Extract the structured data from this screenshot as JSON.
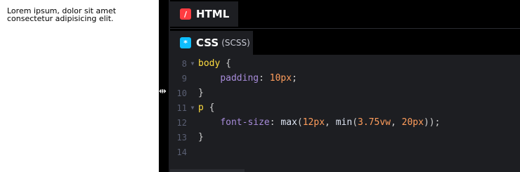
{
  "preview": {
    "text": "Lorem ipsum, dolor sit amet consectetur adipisicing elit."
  },
  "tabs": {
    "html": {
      "icon": "/",
      "title": "HTML"
    },
    "css": {
      "icon": "*",
      "title": "CSS",
      "subtitle": "(SCSS)"
    }
  },
  "code": {
    "lines": [
      {
        "n": "8",
        "fold": true,
        "indent": "",
        "parts": [
          [
            "sel",
            "body"
          ],
          [
            "punc",
            " {"
          ]
        ]
      },
      {
        "n": "9",
        "fold": false,
        "indent": "    ",
        "parts": [
          [
            "prop",
            "padding"
          ],
          [
            "punc",
            ": "
          ],
          [
            "num",
            "10px"
          ],
          [
            "punc",
            ";"
          ]
        ]
      },
      {
        "n": "10",
        "fold": false,
        "indent": "",
        "parts": [
          [
            "punc",
            "}"
          ]
        ]
      },
      {
        "n": "11",
        "fold": true,
        "indent": "",
        "parts": [
          [
            "sel",
            "p"
          ],
          [
            "punc",
            " {"
          ]
        ]
      },
      {
        "n": "12",
        "fold": false,
        "indent": "    ",
        "parts": [
          [
            "prop",
            "font-size"
          ],
          [
            "punc",
            ": "
          ],
          [
            "fn",
            "max"
          ],
          [
            "punc",
            "("
          ],
          [
            "num",
            "12px"
          ],
          [
            "punc",
            ", "
          ],
          [
            "fn",
            "min"
          ],
          [
            "punc",
            "("
          ],
          [
            "num",
            "3.75vw"
          ],
          [
            "punc",
            ", "
          ],
          [
            "num",
            "20px"
          ],
          [
            "punc",
            "));"
          ]
        ]
      },
      {
        "n": "13",
        "fold": false,
        "indent": "",
        "parts": [
          [
            "punc",
            "}"
          ]
        ]
      },
      {
        "n": "14",
        "fold": false,
        "indent": "",
        "parts": []
      }
    ]
  },
  "colors": {
    "html_icon": "#ff3c41",
    "css_icon": "#0ebeff",
    "editor_bg": "#1d1e22",
    "selector": "#ffdd40",
    "property": "#a88cdb",
    "number": "#ff9d5c"
  }
}
